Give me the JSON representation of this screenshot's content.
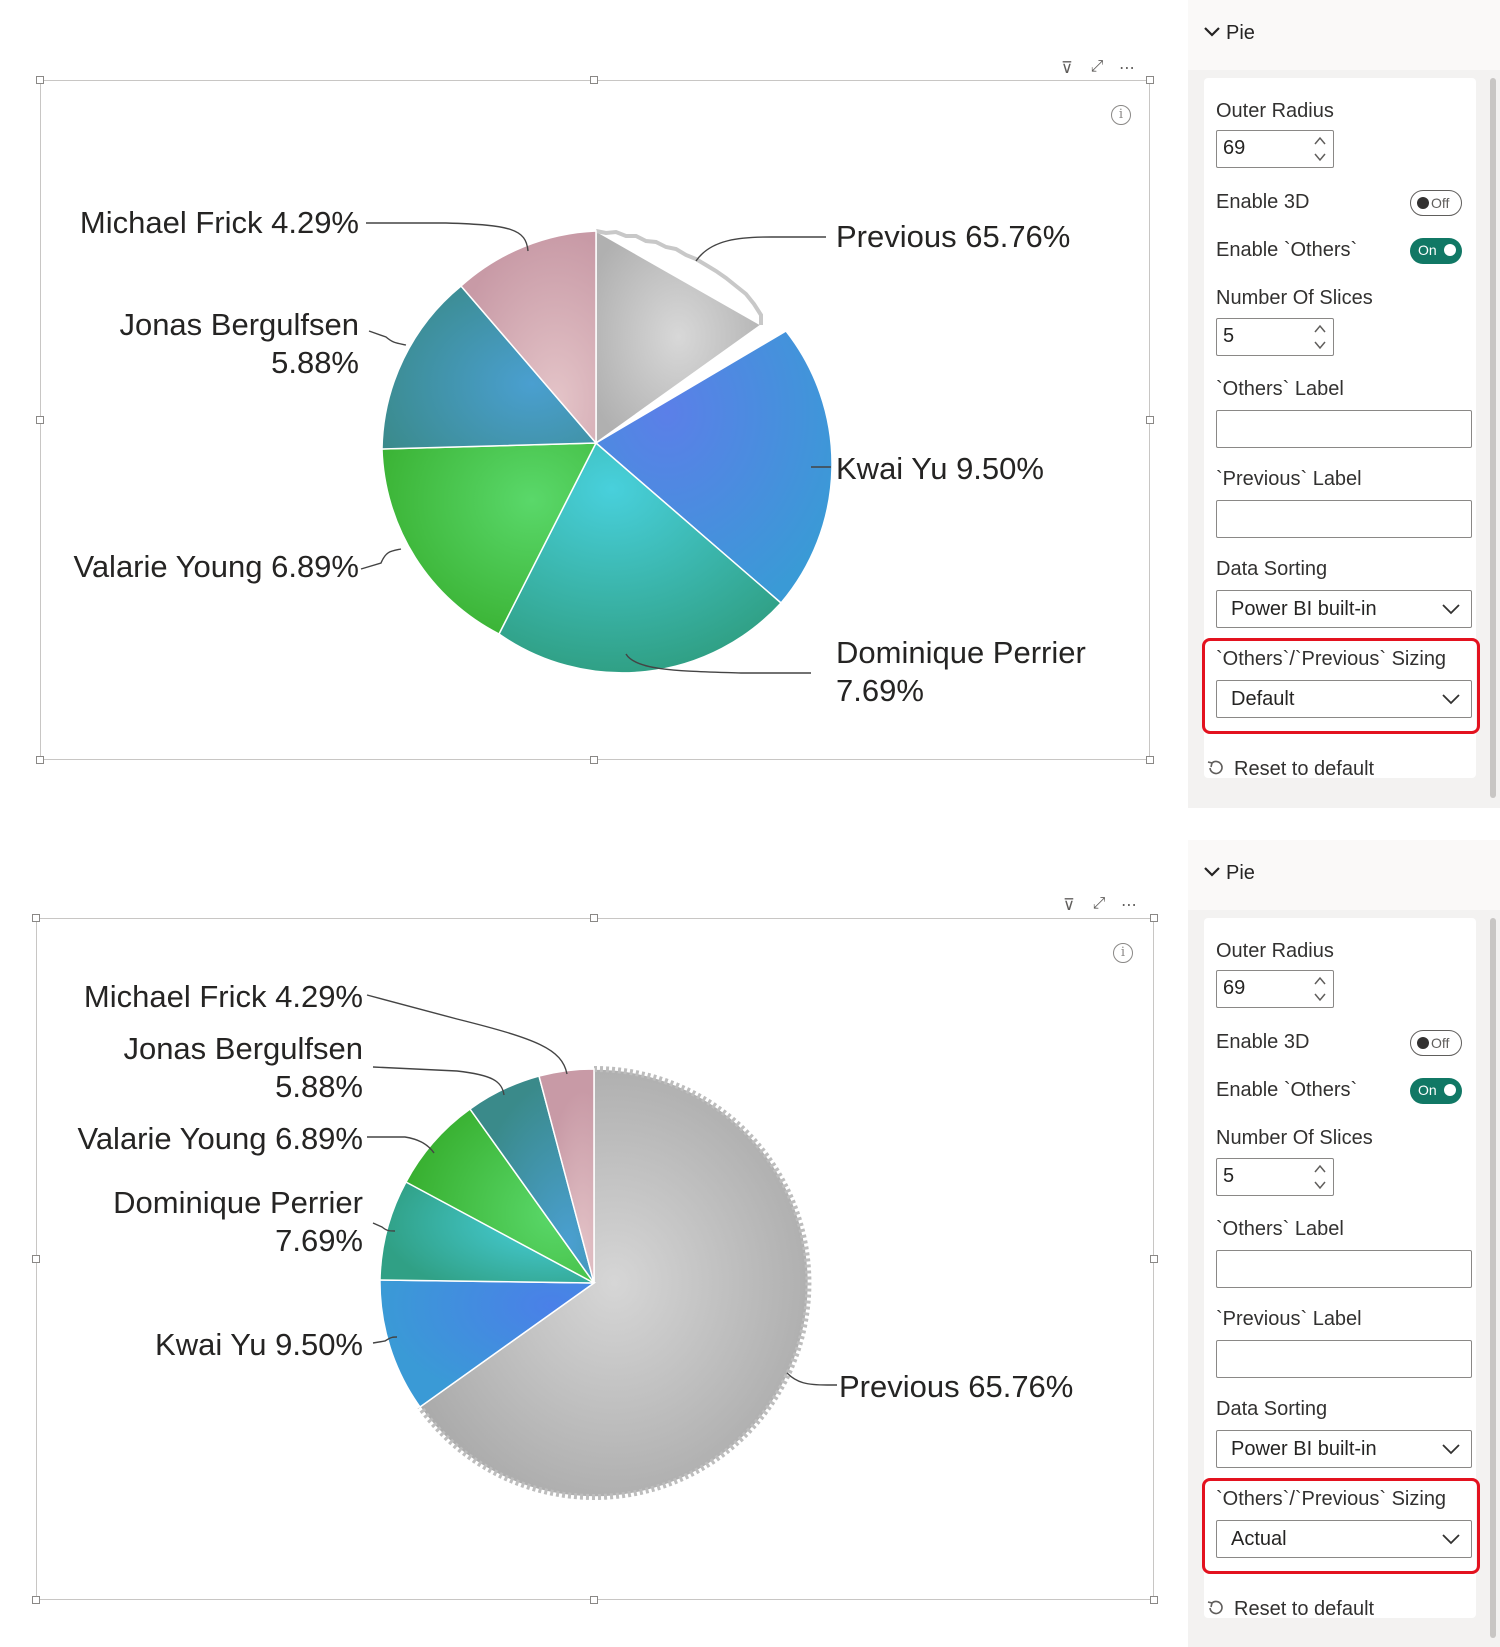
{
  "panels": [
    {
      "visual": {
        "header_icons": [
          "filter-icon",
          "focus-mode-icon",
          "more-options-icon"
        ],
        "slices": [
          {
            "name": "Previous",
            "label": "Previous 65.76%",
            "value": 65.76,
            "color": "#c8c8c8"
          },
          {
            "name": "Kwai Yu",
            "label": "Kwai Yu 9.50%",
            "value": 9.5,
            "color": "#4a86e8"
          },
          {
            "name": "Dominique Perrier",
            "label_line1": "Dominique Perrier",
            "label_line2": "7.69%",
            "value": 7.69,
            "color": "#3fbfb2"
          },
          {
            "name": "Valarie Young",
            "label": "Valarie Young 6.89%",
            "value": 6.89,
            "color": "#4ccc4c"
          },
          {
            "name": "Jonas Bergulfsen",
            "label_line1": "Jonas Bergulfsen",
            "label_line2": "5.88%",
            "value": 5.88,
            "color": "#3a8fa8"
          },
          {
            "name": "Michael Frick",
            "label": "Michael Frick 4.29%",
            "value": 4.29,
            "color": "#d9aab2"
          }
        ]
      },
      "pane": {
        "title": "Pie",
        "outer_radius_label": "Outer Radius",
        "outer_radius_value": "69",
        "enable_3d_label": "Enable 3D",
        "enable_3d_state": "Off",
        "enable_others_label": "Enable `Others`",
        "enable_others_state": "On",
        "number_of_slices_label": "Number Of Slices",
        "number_of_slices_value": "5",
        "others_label_label": "`Others` Label",
        "others_label_value": "",
        "previous_label_label": "`Previous` Label",
        "previous_label_value": "",
        "data_sorting_label": "Data Sorting",
        "data_sorting_value": "Power BI built-in",
        "sizing_label": "`Others`/`Previous` Sizing",
        "sizing_value": "Default",
        "reset_label": "Reset to default"
      }
    },
    {
      "visual": {
        "header_icons": [
          "filter-icon",
          "focus-mode-icon",
          "more-options-icon"
        ],
        "slices": [
          {
            "name": "Previous",
            "label": "Previous 65.76%",
            "value": 65.76,
            "color": "#c8c8c8"
          },
          {
            "name": "Kwai Yu",
            "label": "Kwai Yu 9.50%",
            "value": 9.5,
            "color": "#4a86e8"
          },
          {
            "name": "Dominique Perrier",
            "label_line1": "Dominique Perrier",
            "label_line2": "7.69%",
            "value": 7.69,
            "color": "#3fbfb2"
          },
          {
            "name": "Valarie Young",
            "label": "Valarie Young 6.89%",
            "value": 6.89,
            "color": "#4ccc4c"
          },
          {
            "name": "Jonas Bergulfsen",
            "label_line1": "Jonas Bergulfsen",
            "label_line2": "5.88%",
            "value": 5.88,
            "color": "#3a8fa8"
          },
          {
            "name": "Michael Frick",
            "label": "Michael Frick 4.29%",
            "value": 4.29,
            "color": "#d9aab2"
          }
        ]
      },
      "pane": {
        "title": "Pie",
        "outer_radius_label": "Outer Radius",
        "outer_radius_value": "69",
        "enable_3d_label": "Enable 3D",
        "enable_3d_state": "Off",
        "enable_others_label": "Enable `Others`",
        "enable_others_state": "On",
        "number_of_slices_label": "Number Of Slices",
        "number_of_slices_value": "5",
        "others_label_label": "`Others` Label",
        "others_label_value": "",
        "previous_label_label": "`Previous` Label",
        "previous_label_value": "",
        "data_sorting_label": "Data Sorting",
        "data_sorting_value": "Power BI built-in",
        "sizing_label": "`Others`/`Previous` Sizing",
        "sizing_value": "Actual",
        "reset_label": "Reset to default"
      }
    }
  ],
  "chart_data": [
    {
      "type": "pie",
      "title": "",
      "sizing_mode": "Default",
      "categories": [
        "Previous",
        "Kwai Yu",
        "Dominique Perrier",
        "Valarie Young",
        "Jonas Bergulfsen",
        "Michael Frick"
      ],
      "values": [
        65.76,
        9.5,
        7.69,
        6.89,
        5.88,
        4.29
      ]
    },
    {
      "type": "pie",
      "title": "",
      "sizing_mode": "Actual",
      "categories": [
        "Previous",
        "Kwai Yu",
        "Dominique Perrier",
        "Valarie Young",
        "Jonas Bergulfsen",
        "Michael Frick"
      ],
      "values": [
        65.76,
        9.5,
        7.69,
        6.89,
        5.88,
        4.29
      ]
    }
  ]
}
